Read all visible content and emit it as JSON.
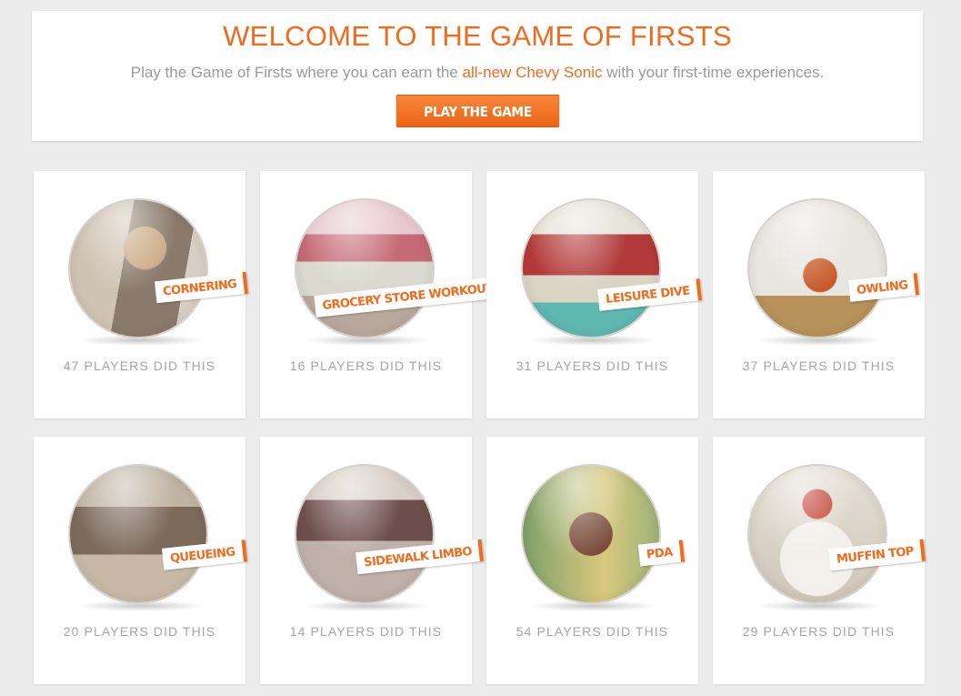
{
  "hero": {
    "title": "WELCOME TO THE GAME OF FIRSTS",
    "subtitle_pre": "Play the Game of Firsts where you can earn the ",
    "subtitle_link": "all-new Chevy Sonic",
    "subtitle_post": " with your first-time experiences.",
    "button_label": "PLAY THE GAME"
  },
  "cards": [
    {
      "tag": "CORNERING",
      "count": "47 PLAYERS DID THIS"
    },
    {
      "tag": "GROCERY STORE WORKOUT",
      "count": "16 PLAYERS DID THIS"
    },
    {
      "tag": "LEISURE DIVE",
      "count": "31 PLAYERS DID THIS"
    },
    {
      "tag": "OWLING",
      "count": "37 PLAYERS DID THIS"
    },
    {
      "tag": "QUEUEING",
      "count": "20 PLAYERS DID THIS"
    },
    {
      "tag": "SIDEWALK LIMBO",
      "count": "14 PLAYERS DID THIS"
    },
    {
      "tag": "PDA",
      "count": "54 PLAYERS DID THIS"
    },
    {
      "tag": "MUFFIN TOP",
      "count": "29 PLAYERS DID THIS"
    }
  ],
  "colors": {
    "accent": "#f26b1d",
    "muted_text": "#a6a6a6",
    "page_bg": "#ececec"
  }
}
